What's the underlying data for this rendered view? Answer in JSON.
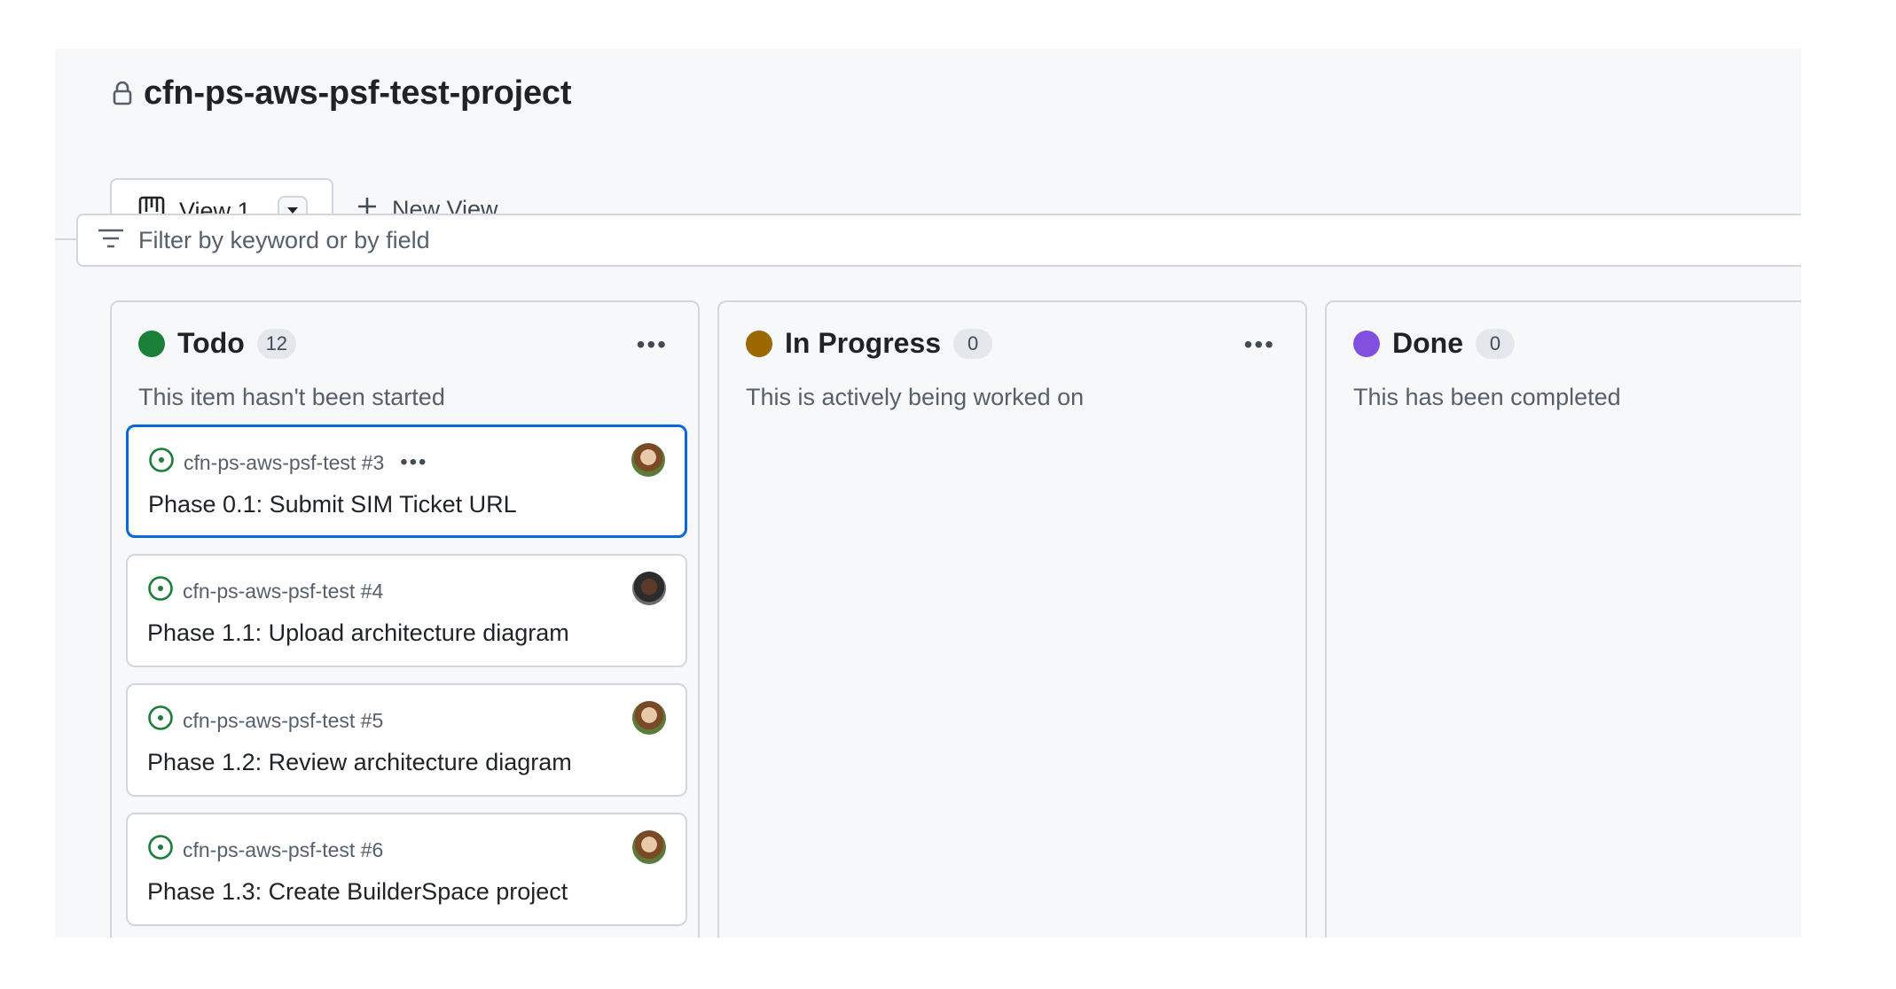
{
  "project": {
    "title": "cfn-ps-aws-psf-test-project"
  },
  "views": {
    "active_tab": "View 1",
    "new_view_label": "New View"
  },
  "filter": {
    "placeholder": "Filter by keyword or by field"
  },
  "colors": {
    "todo": "#1a7f37",
    "in_progress": "#9a6700",
    "done": "#8250df",
    "selected_border": "#0969da"
  },
  "columns": [
    {
      "name": "Todo",
      "count": "12",
      "description": "This item hasn't been started",
      "cards": [
        {
          "ref": "cfn-ps-aws-psf-test #3",
          "title": "Phase 0.1: Submit SIM Ticket URL"
        },
        {
          "ref": "cfn-ps-aws-psf-test #4",
          "title": "Phase 1.1: Upload architecture diagram"
        },
        {
          "ref": "cfn-ps-aws-psf-test #5",
          "title": "Phase 1.2: Review architecture diagram"
        },
        {
          "ref": "cfn-ps-aws-psf-test #6",
          "title": "Phase 1.3: Create BuilderSpace project"
        }
      ]
    },
    {
      "name": "In Progress",
      "count": "0",
      "description": "This is actively being worked on",
      "cards": []
    },
    {
      "name": "Done",
      "count": "0",
      "description": "This has been completed",
      "cards": []
    }
  ],
  "menu_glyph": "•••"
}
